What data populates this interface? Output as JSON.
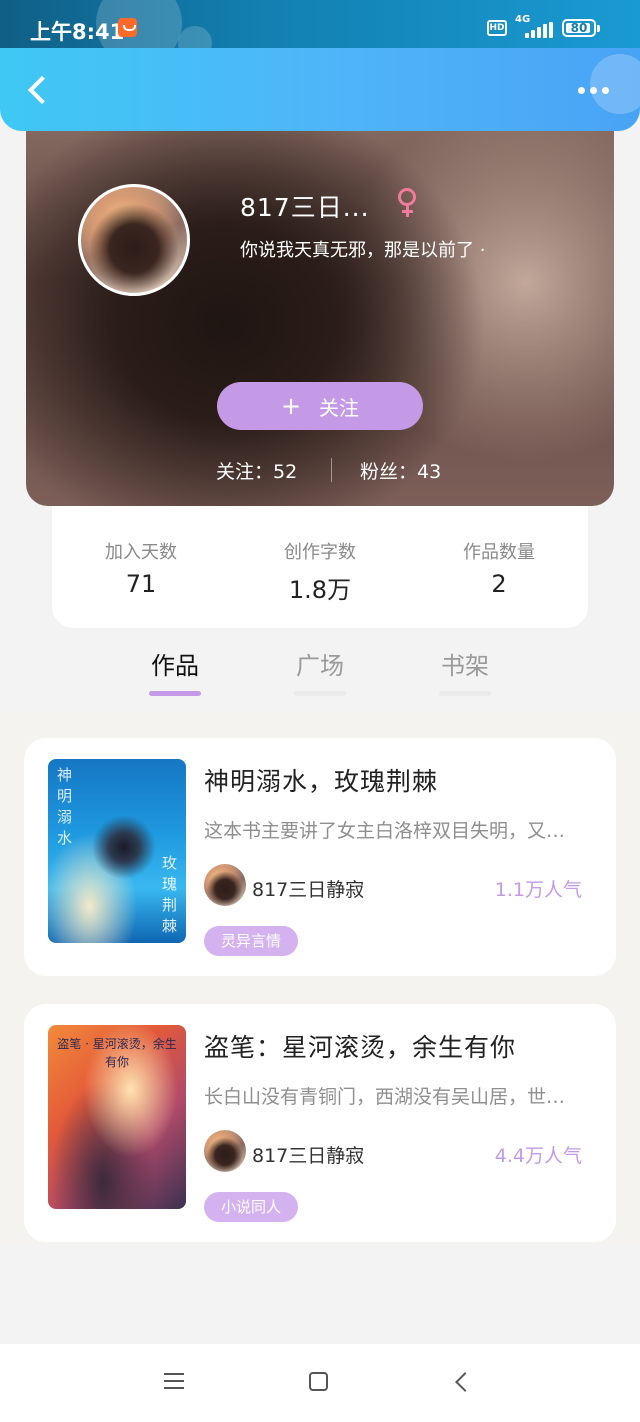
{
  "status_bar": {
    "time": "上午8:41",
    "network": "4G",
    "hd_label": "HD",
    "battery": "80"
  },
  "icons": {
    "back": "back-arrow-icon",
    "more": "more-dots-icon",
    "gender": "female-icon",
    "follow": "plus-icon",
    "nav_menu": "menu-icon",
    "nav_home": "home-square-icon",
    "nav_back": "back-chevron-icon"
  },
  "colors": {
    "header": "#4fb4f9",
    "accent": "#c49ae6",
    "gender": "#f27a9a",
    "tag": "#d4b2f0"
  },
  "profile": {
    "username": "817三日...",
    "signature": "你说我天真无邪，那是以前了 ·",
    "follow_button": "关注",
    "follow_plus": "+",
    "following": "关注：52",
    "followers": "粉丝：43"
  },
  "stats": [
    {
      "label": "加入天数",
      "value": "71"
    },
    {
      "label": "创作字数",
      "value": "1.8万"
    },
    {
      "label": "作品数量",
      "value": "2"
    }
  ],
  "tabs": [
    {
      "label": "作品",
      "active": true
    },
    {
      "label": "广场",
      "active": false
    },
    {
      "label": "书架",
      "active": false
    }
  ],
  "works": [
    {
      "title": "神明溺水，玫瑰荆棘",
      "description": "这本书主要讲了女主白洛梓双目失明，又…",
      "author": "817三日静寂",
      "popularity": "1.1万人气",
      "tag": "灵异言情",
      "cover_text_left": "神明溺水",
      "cover_text_right": "玫瑰荆棘"
    },
    {
      "title": "盗笔：星河滚烫，余生有你",
      "description": "长白山没有青铜门，西湖没有吴山居，世…",
      "author": "817三日静寂",
      "popularity": "4.4万人气",
      "tag": "小说同人",
      "cover_text": "盗笔 · 星河滚烫，余生有你"
    }
  ]
}
